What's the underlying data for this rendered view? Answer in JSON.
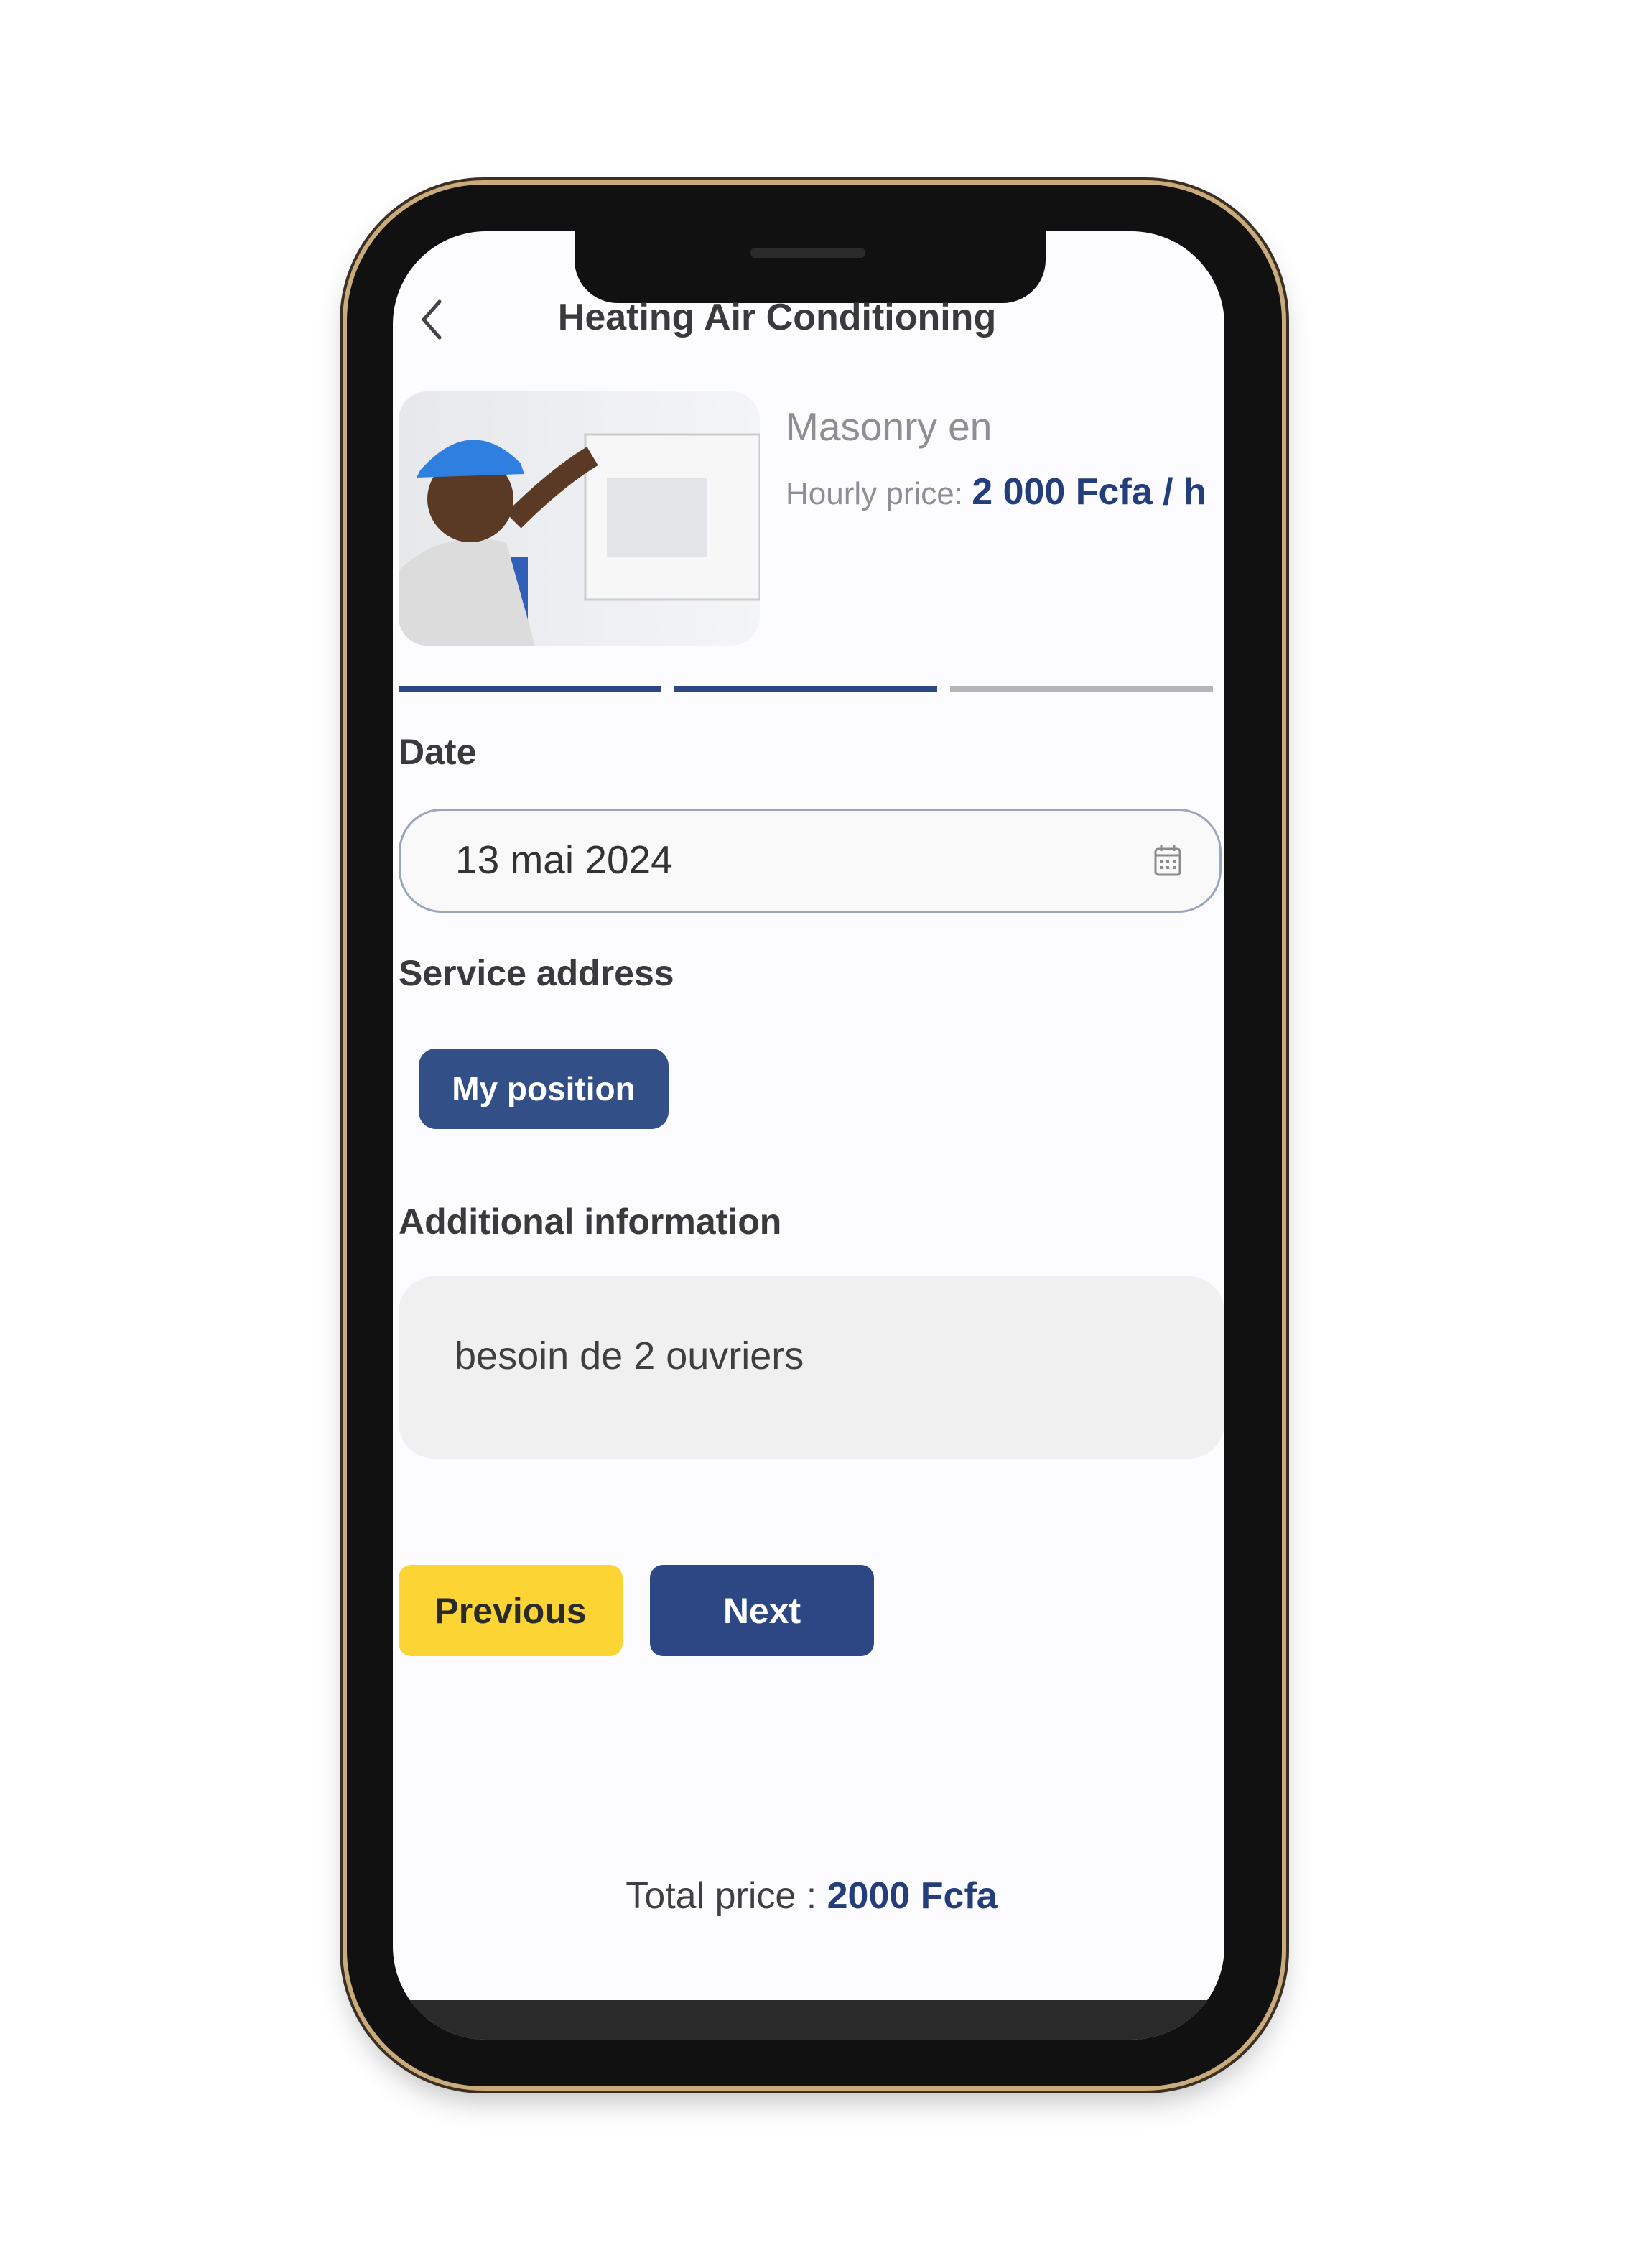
{
  "header": {
    "title": "Heating Air Conditioning",
    "back_icon": "chevron-left-icon"
  },
  "service": {
    "name": "Masonry en",
    "price_label": "Hourly price:",
    "price_value": "2 000 Fcfa / h"
  },
  "steps": {
    "total": 3,
    "completed": 2,
    "active_color": "#2c4783",
    "inactive_color": "#b5b5b5"
  },
  "form": {
    "date_label": "Date",
    "date_value": "13 mai 2024",
    "date_icon": "calendar-icon",
    "address_label": "Service address",
    "my_position_label": "My position",
    "info_label": "Additional information",
    "info_value": "besoin de 2 ouvriers"
  },
  "actions": {
    "previous_label": "Previous",
    "next_label": "Next"
  },
  "footer": {
    "total_label": "Total price :",
    "total_value": "2000 Fcfa"
  },
  "colors": {
    "primary": "#2c4783",
    "accent": "#fcd535"
  }
}
